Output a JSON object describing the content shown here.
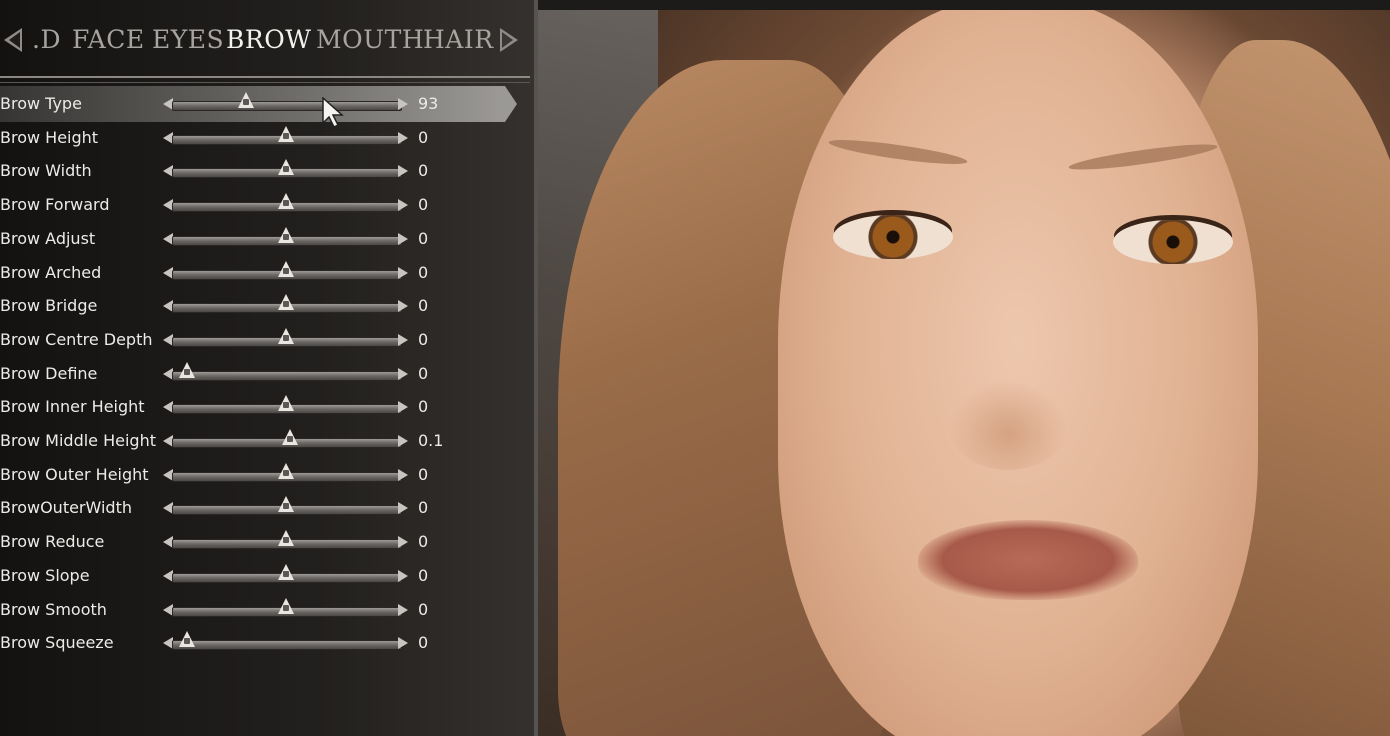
{
  "tabs": [
    {
      "label": "HEAD",
      "display": ".D",
      "active": false
    },
    {
      "label": "FACE",
      "active": false
    },
    {
      "label": "EYES",
      "active": false
    },
    {
      "label": "BROW",
      "active": true
    },
    {
      "label": "MOUTH",
      "active": false
    },
    {
      "label": "HAIR",
      "active": false
    }
  ],
  "sliders": [
    {
      "label": "Brow Type",
      "value": "93",
      "fraction": 0.32,
      "selected": true
    },
    {
      "label": "Brow Height",
      "value": "0",
      "fraction": 0.5
    },
    {
      "label": "Brow Width",
      "value": "0",
      "fraction": 0.5
    },
    {
      "label": "Brow Forward",
      "value": "0",
      "fraction": 0.5
    },
    {
      "label": "Brow Adjust",
      "value": "0",
      "fraction": 0.5
    },
    {
      "label": "Brow Arched",
      "value": "0",
      "fraction": 0.5
    },
    {
      "label": "Brow Bridge",
      "value": "0",
      "fraction": 0.5
    },
    {
      "label": "Brow Centre Depth",
      "value": "0",
      "fraction": 0.5
    },
    {
      "label": "Brow Define",
      "value": "0",
      "fraction": 0.05
    },
    {
      "label": "Brow Inner Height",
      "value": "0",
      "fraction": 0.5
    },
    {
      "label": "Brow Middle Height",
      "value": "0.1",
      "fraction": 0.52
    },
    {
      "label": "Brow Outer Height",
      "value": "0",
      "fraction": 0.5
    },
    {
      "label": "BrowOuterWidth",
      "value": "0",
      "fraction": 0.5
    },
    {
      "label": "Brow Reduce",
      "value": "0",
      "fraction": 0.5
    },
    {
      "label": "Brow Slope",
      "value": "0",
      "fraction": 0.5
    },
    {
      "label": "Brow Smooth",
      "value": "0",
      "fraction": 0.5
    },
    {
      "label": "Brow Squeeze",
      "value": "0",
      "fraction": 0.05
    }
  ],
  "colors": {
    "panel": "#1e1c1a",
    "text": "#ecebe8",
    "tab_inactive": "#a7a4a0",
    "tab_active": "#f4f2ee"
  }
}
